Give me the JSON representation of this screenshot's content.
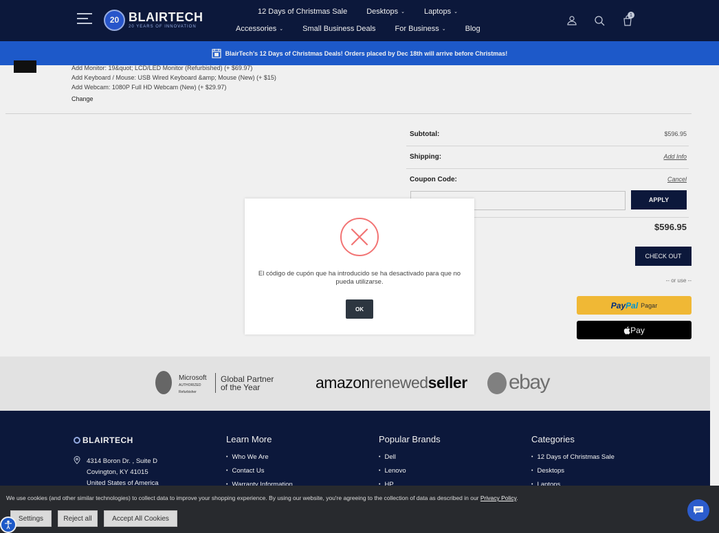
{
  "header": {
    "logo_badge": "20",
    "logo_name": "BLAIRTECH",
    "logo_tagline": "20 YEARS OF INNOVATION",
    "nav_row1": [
      {
        "label": "12 Days of Christmas Sale",
        "has_dropdown": false
      },
      {
        "label": "Desktops",
        "has_dropdown": true
      },
      {
        "label": "Laptops",
        "has_dropdown": true
      }
    ],
    "nav_row2": [
      {
        "label": "Accessories",
        "has_dropdown": true
      },
      {
        "label": "Small Business Deals",
        "has_dropdown": false
      },
      {
        "label": "For Business",
        "has_dropdown": true
      },
      {
        "label": "Blog",
        "has_dropdown": false
      }
    ],
    "icons": [
      "menu-icon",
      "user-icon",
      "search-icon",
      "cart-icon"
    ],
    "cart_count": "1",
    "background_color": "#0d1a3f"
  },
  "promo_banner": {
    "text": "BlairTech's 12 Days of Christmas Deals! Orders placed by Dec 18th will arrive before Christmas!",
    "background_color": "#1f5fd6"
  },
  "cart_item": {
    "options": [
      "Add Monitor: 19&quot; LCD/LED Monitor (Refurbished) (+ $69.97)",
      "Add Keyboard / Mouse: USB Wired Keyboard &amp; Mouse (New) (+ $15)",
      "Add Webcam: 1080P Full HD Webcam (New) (+ $29.97)"
    ],
    "change_label": "Change"
  },
  "totals": {
    "subtotal_label": "Subtotal:",
    "subtotal_value": "$596.95",
    "shipping_label": "Shipping:",
    "shipping_link": "Add Info",
    "coupon_label": "Coupon Code:",
    "coupon_link": "Cancel",
    "coupon_value": "",
    "apply_label": "APPLY",
    "grand_total": "$596.95",
    "checkout_label": "CHECK OUT",
    "or_use": "-- or use --",
    "paypal_part1": "Pay",
    "paypal_part2": "Pal",
    "paypal_sub": "Pagar",
    "applepay_label": "Pay"
  },
  "partners": {
    "microsoft_name": "Microsoft",
    "microsoft_authorized": "AUTHORIZED",
    "microsoft_refurbisher": "Refurbisher",
    "global_partner": "Global Partner",
    "of_the_year": "of the Year",
    "amazon_1": "amazon",
    "amazon_2": "renewed",
    "amazon_3": "seller",
    "ebay": "ebay"
  },
  "footer": {
    "logo": "BLAIRTECH",
    "address": [
      "4314 Boron Dr. , Suite D",
      "Covington, KY 41015",
      "United States of America"
    ],
    "columns": [
      {
        "title": "Learn More",
        "items": [
          "Who We Are",
          "Contact Us",
          "Warranty Information"
        ]
      },
      {
        "title": "Popular Brands",
        "items": [
          "Dell",
          "Lenovo",
          "HP"
        ]
      },
      {
        "title": "Categories",
        "items": [
          "12 Days of Christmas Sale",
          "Desktops",
          "Laptops"
        ]
      }
    ]
  },
  "modal": {
    "message": "El código de cupón que ha introducido se ha desactivado para que no pueda utilizarse.",
    "ok_label": "OK",
    "icon_color": "#f27474"
  },
  "cookie_bar": {
    "text": "We use cookies (and other similar technologies) to collect data to improve your shopping experience. By using our website, you're agreeing to the collection of data as described in our",
    "policy_link": "Privacy Policy",
    "settings_label": "Settings",
    "reject_label": "Reject all",
    "accept_label": "Accept All Cookies"
  }
}
